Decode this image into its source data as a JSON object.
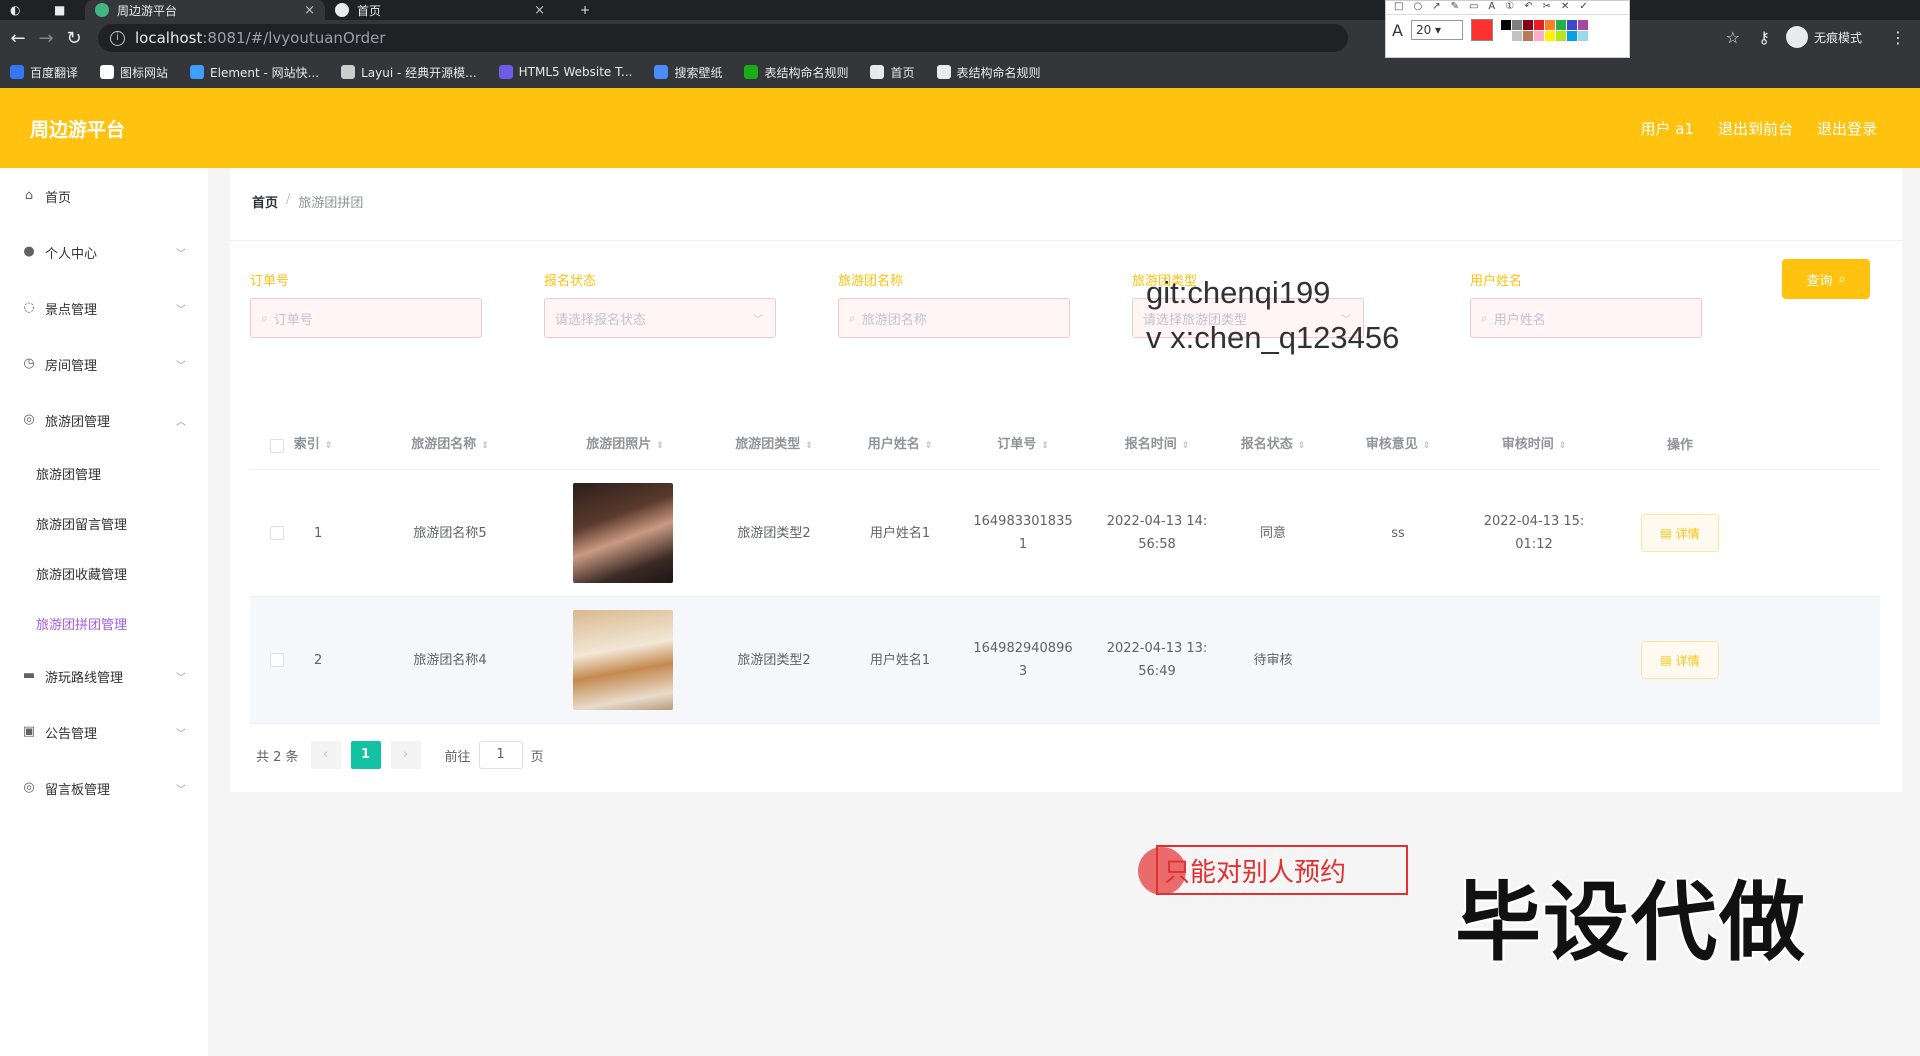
{
  "browser": {
    "tabs": [
      {
        "title": "周边游平台",
        "active": true
      },
      {
        "title": "首页",
        "active": false
      }
    ],
    "new_tab": "+",
    "url_host": "localhost",
    "url_rest": ":8081/#/lvyoutuanOrder",
    "bookmarks": [
      {
        "label": "百度翻译",
        "color": "#3478f6"
      },
      {
        "label": "图标网站",
        "color": "#ffffff"
      },
      {
        "label": "Element - 网站快...",
        "color": "#409eff"
      },
      {
        "label": "Layui - 经典开源模...",
        "color": "#cccccc"
      },
      {
        "label": "HTML5 Website T...",
        "color": "#6c5ce7"
      },
      {
        "label": "搜索壁纸",
        "color": "#4b8bf5"
      },
      {
        "label": "表结构命名规则",
        "color": "#1aad19"
      },
      {
        "label": "首页",
        "color": "#e8eaed"
      },
      {
        "label": "表结构命名规则",
        "color": "#e8eaed"
      }
    ],
    "incognito_label": "无痕模式"
  },
  "annotation_tool": {
    "font_size": "20",
    "current_color": "#ff3030",
    "palette": [
      "#000000",
      "#7f7f7f",
      "#880015",
      "#ed1c24",
      "#ff7f27",
      "#22b14c",
      "#3f48cc",
      "#a349a4",
      "#ffffff",
      "#c3c3c3",
      "#b97a57",
      "#ffaec9",
      "#fff200",
      "#b5e61d",
      "#00a2e8",
      "#99d9ea"
    ]
  },
  "header": {
    "title": "周边游平台",
    "links": [
      "用户 a1",
      "退出到前台",
      "退出登录"
    ]
  },
  "sidebar": {
    "items": [
      {
        "label": "首页",
        "icon": "home-icon",
        "glyph": "⌂",
        "has_chevron": false
      },
      {
        "label": "个人中心",
        "icon": "user-icon",
        "glyph": "●",
        "has_chevron": true
      },
      {
        "label": "景点管理",
        "icon": "power-icon",
        "glyph": "◌",
        "has_chevron": true
      },
      {
        "label": "房间管理",
        "icon": "clock-icon",
        "glyph": "◷",
        "has_chevron": true
      },
      {
        "label": "旅游团管理",
        "icon": "compass-icon",
        "glyph": "◎",
        "has_chevron": true,
        "expanded": true
      }
    ],
    "subitems": [
      {
        "label": "旅游团管理",
        "active": false
      },
      {
        "label": "旅游团留言管理",
        "active": false
      },
      {
        "label": "旅游团收藏管理",
        "active": false
      },
      {
        "label": "旅游团拼团管理",
        "active": true
      }
    ],
    "items_after": [
      {
        "label": "游玩路线管理",
        "icon": "briefcase-icon",
        "glyph": "▬"
      },
      {
        "label": "公告管理",
        "icon": "clipboard-icon",
        "glyph": "▣"
      },
      {
        "label": "留言板管理",
        "icon": "compass-icon",
        "glyph": "◎"
      }
    ]
  },
  "breadcrumb": {
    "home": "首页",
    "separator": "/",
    "current": "旅游团拼团"
  },
  "filters": [
    {
      "label": "订单号",
      "placeholder": "订单号",
      "type": "search"
    },
    {
      "label": "报名状态",
      "placeholder": "请选择报名状态",
      "type": "select"
    },
    {
      "label": "旅游团名称",
      "placeholder": "旅游团名称",
      "type": "search"
    },
    {
      "label": "旅游团类型",
      "placeholder": "请选择旅游团类型",
      "type": "select"
    },
    {
      "label": "用户姓名",
      "placeholder": "用户姓名",
      "type": "search"
    }
  ],
  "query_button": "查询",
  "watermark_lines": [
    "git:chenqi199",
    "v x:chen_q123456"
  ],
  "table": {
    "columns": [
      "索引",
      "旅游团名称",
      "旅游团照片",
      "旅游团类型",
      "用户姓名",
      "订单号",
      "报名时间",
      "报名状态",
      "审核意见",
      "审核时间",
      "操作"
    ],
    "rows": [
      {
        "index": "1",
        "name": "旅游团名称5",
        "photo": "portrait-photo",
        "type": "旅游团类型2",
        "user": "用户姓名1",
        "order_a": "164983301835",
        "order_b": "1",
        "time_a": "2022-04-13 14:",
        "time_b": "56:58",
        "status": "同意",
        "opinion": "ss",
        "audit_a": "2022-04-13 15:",
        "audit_b": "01:12",
        "action": "详情"
      },
      {
        "index": "2",
        "name": "旅游团名称4",
        "photo": "dog-photo",
        "type": "旅游团类型2",
        "user": "用户姓名1",
        "order_a": "164982940896",
        "order_b": "3",
        "time_a": "2022-04-13 13:",
        "time_b": "56:49",
        "status": "待审核",
        "opinion": "",
        "audit_a": "",
        "audit_b": "",
        "action": "详情"
      }
    ]
  },
  "pagination": {
    "total_text": "共 2 条",
    "prev": "‹",
    "current": "1",
    "next": "›",
    "goto_label": "前往",
    "goto_value": "1",
    "page_unit": "页"
  },
  "overlay": {
    "note": "只能对别人预约",
    "banner": "毕设代做"
  }
}
